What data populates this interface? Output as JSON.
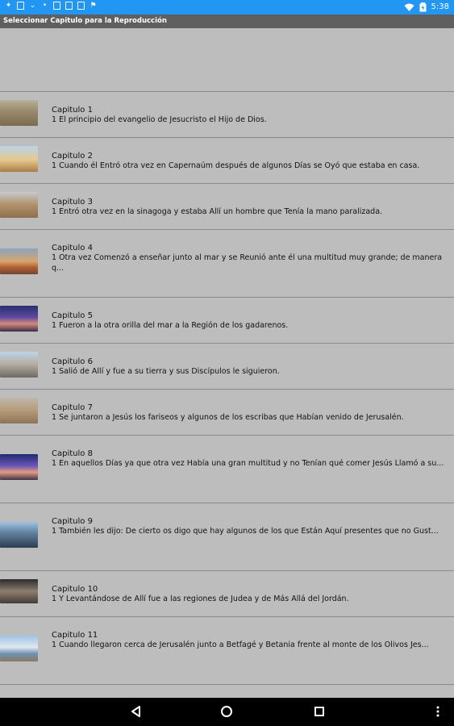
{
  "status_bar": {
    "left_icons": [
      "usb-icon",
      "facebook-icon",
      "download-icon",
      "mic-icon",
      "document-icon",
      "image-icon",
      "message-icon",
      "flag-icon"
    ],
    "time": "5:38"
  },
  "title_bar": {
    "title": "Seleccionar Capitulo para la Reproducción"
  },
  "chapters": [
    {
      "title": "Capitulo 1",
      "text": "1 El principio del evangelio de Jesucristo  el Hijo de Dios."
    },
    {
      "title": "Capitulo 2",
      "text": "1 Cuando él Entró otra vez en Capernaúm después de algunos Días  se Oyó que estaba en casa."
    },
    {
      "title": "Capitulo 3",
      "text": "1 Entró otra vez en la sinagoga  y estaba Allí un hombre que Tenía la mano paralizada."
    },
    {
      "title": "Capitulo 4",
      "text": "1 Otra vez Comenzó a enseñar junto al mar  y se Reunió ante él una multitud muy grande; de manera q..."
    },
    {
      "title": "Capitulo 5",
      "text": "1 Fueron a la otra orilla del mar a la Región de los gadarenos."
    },
    {
      "title": "Capitulo 6",
      "text": "1 Salió de Allí y fue a su tierra  y sus Discípulos le siguieron."
    },
    {
      "title": "Capitulo 7",
      "text": "1 Se juntaron a Jesús los fariseos y algunos de los escribas que Habían venido de Jerusalén."
    },
    {
      "title": "Capitulo 8",
      "text": "1 En aquellos Días  ya que otra vez Había una gran multitud y no Tenían qué comer  Jesús Llamó a su..."
    },
    {
      "title": "Capitulo 9",
      "text": "1 También les dijo:   De cierto os digo que hay algunos de los que Están Aquí presentes que no Gust..."
    },
    {
      "title": "Capitulo 10",
      "text": "1 Y Levantándose de Allí  fue a las regiones de Judea y de Más Allá del Jordán."
    },
    {
      "title": "Capitulo 11",
      "text": "1 Cuando llegaron cerca de Jerusalén  junto a Betfagé y Betania  frente al monte de los Olivos Jes..."
    }
  ],
  "nav_bar": {
    "buttons": [
      "back-icon",
      "home-icon",
      "recents-icon",
      "more-icon"
    ]
  }
}
